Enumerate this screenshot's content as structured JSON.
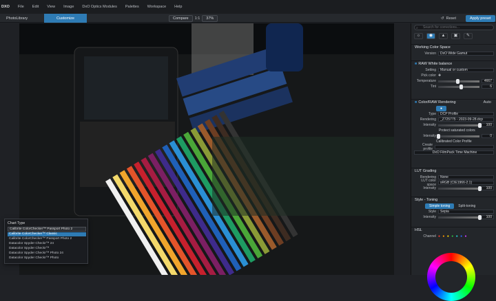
{
  "menu": {
    "app": "DXO",
    "items": [
      "File",
      "Edit",
      "View",
      "Image",
      "DxO Optics Modules",
      "Palettes",
      "Workspace",
      "Help"
    ]
  },
  "tabs": {
    "library": "PhotoLibrary",
    "customize": "Customize"
  },
  "toolbar": {
    "compare": "Compare",
    "zoom_fit": "1:1",
    "zoom": "37%",
    "reset": "Reset",
    "apply_preset": "Apply preset"
  },
  "panel": {
    "search_placeholder": "Search for corrections...",
    "working_color_space": {
      "title": "Working Color Space",
      "version_label": "Version",
      "version_value": "DxO Wide Gamut"
    },
    "white_balance": {
      "title": "RAW White balance",
      "setting_label": "Setting",
      "setting_value": "Manual or custom",
      "pick_label": "Pick color",
      "temperature_label": "Temperature",
      "temperature_value": "4667",
      "temperature_fraction": 0.48,
      "tint_label": "Tint",
      "tint_value": "6",
      "tint_fraction": 0.55
    },
    "color_rendering": {
      "title": "Color/RAW Rendering",
      "auto": "Auto",
      "type_label": "Type",
      "type_value": "DCP Profile",
      "rendering_label": "Rendering",
      "rendering_value": "_Z725775 - 2023-09-28.dcp",
      "intensity_label": "Intensity",
      "intensity_value": "100",
      "intensity_fraction": 1.0,
      "protect": "Protect saturated colors",
      "intensity2_label": "Intensity",
      "intensity2_value": "0",
      "intensity2_fraction": 0.0,
      "calibrated": "Calibrated Color Profile",
      "create_profile": "Create profile",
      "filmpack": "DxO FilmPack Time Machine"
    },
    "lut": {
      "title": "LUT Grading",
      "rendering_label": "Rendering",
      "rendering_value": "None",
      "space_label": "LUT color space",
      "space_value": "sRGB (CIE1966-2.1)",
      "intensity_label": "Intensity",
      "intensity_value": "100",
      "intensity_fraction": 1.0
    },
    "style": {
      "title": "Style - Toning",
      "simple": "Simple toning",
      "split": "Split-toning",
      "style_label": "Style",
      "style_value": "Sepia",
      "intensity_label": "Intensity",
      "intensity_value": "100",
      "intensity_fraction": 1.0
    },
    "hsl": {
      "title": "HSL",
      "channel_label": "Channel"
    }
  },
  "chart_dialog": {
    "title": "Chart Type",
    "selected": "Calibrite ColorChecker™ Passport Photo 2",
    "options": [
      "Calibrite ColorChecker™ Classic",
      "Calibrite ColorChecker™ Passport Photo 2",
      "Datacolor Spyder Checkr™ 24",
      "Datacolor Spyder Checkr™",
      "Datacolor Spyder Checkr™ Photo 24",
      "Datacolor Spyder Checkr™ Photo"
    ]
  }
}
